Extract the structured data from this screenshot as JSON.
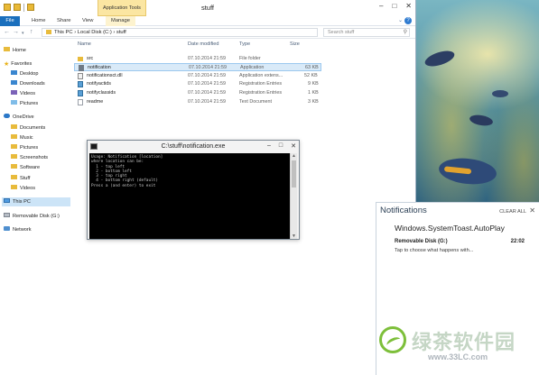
{
  "explorer": {
    "title": "stuff",
    "context_tab": "Application Tools",
    "ribbon_tabs": [
      "File",
      "Home",
      "Share",
      "View",
      "Manage"
    ],
    "address_path": "This PC › Local Disk (C:) › stuff",
    "search_placeholder": "Search stuff",
    "columns": {
      "name": "Name",
      "date": "Date modified",
      "type": "Type",
      "size": "Size"
    },
    "nav": {
      "home": "Home",
      "favorites": "Favorites",
      "desktop": "Desktop",
      "downloads": "Downloads",
      "videos": "Videos",
      "pictures": "Pictures",
      "onedrive": "OneDrive",
      "od_documents": "Documents",
      "od_music": "Music",
      "od_pictures": "Pictures",
      "od_screenshots": "Screenshots",
      "od_software": "Software",
      "od_stuff": "Stuff",
      "od_videos": "Videos",
      "thispc": "This PC",
      "removable": "Removable Disk (G:)",
      "network": "Network"
    },
    "files": [
      {
        "name": "src",
        "date": "07.10.2014 21:59",
        "type": "File folder",
        "size": ""
      },
      {
        "name": "notification",
        "date": "07.10.2014 21:59",
        "type": "Application",
        "size": "63 KB"
      },
      {
        "name": "notificationsct.dll",
        "date": "07.10.2014 21:59",
        "type": "Application extens...",
        "size": "52 KB"
      },
      {
        "name": "notifyactids",
        "date": "07.10.2014 21:59",
        "type": "Registration Entries",
        "size": "9 KB"
      },
      {
        "name": "notifyclassids",
        "date": "07.10.2014 21:59",
        "type": "Registration Entries",
        "size": "1 KB"
      },
      {
        "name": "readme",
        "date": "07.10.2014 21:59",
        "type": "Text Document",
        "size": "3 KB"
      }
    ]
  },
  "console": {
    "title": "C:\\stuff\\notification.exe",
    "lines": [
      "Usage: Notification [location]",
      "where location can be:",
      "  1 - top left",
      "  2 - bottom left",
      "  3 - top right",
      "  4 - bottom right (default)",
      "Press a (and enter) to exit"
    ]
  },
  "notifications": {
    "title": "Notifications",
    "clear_all": "CLEAR ALL",
    "app_name": "Windows.SystemToast.AutoPlay",
    "item_title": "Removable Disk (G:)",
    "item_time": "22:02",
    "item_body": "Tap to choose what happens with..."
  },
  "watermark": {
    "text": "绿茶软件园",
    "url": "www.33LC.com"
  },
  "colors": {
    "file_tab": "#1a6fbd",
    "context_tab": "#fbe6a2",
    "selection": "#d9eaf8",
    "console_bg": "#000000"
  }
}
